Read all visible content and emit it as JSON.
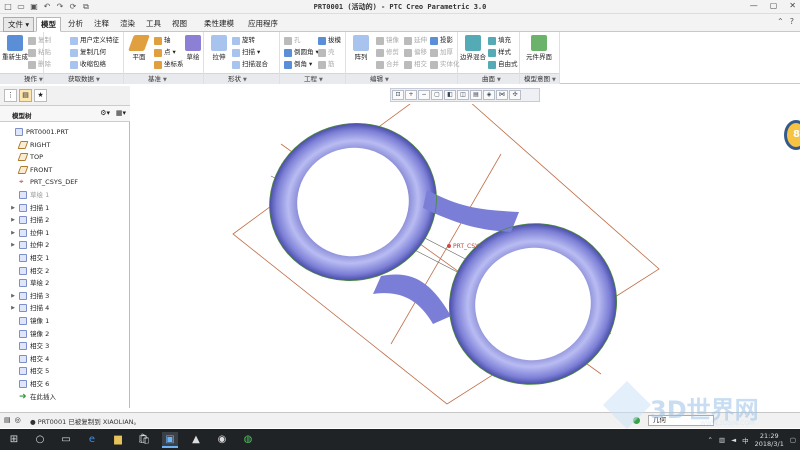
{
  "titlebar": {
    "title": "PRT0001 (活动的) - PTC Creo Parametric 3.0",
    "qat": [
      "new-icon",
      "open-icon",
      "save-icon",
      "undo-icon",
      "redo-icon",
      "regenerate-icon",
      "windows-icon"
    ],
    "controls": [
      "—",
      "▢",
      "✕"
    ]
  },
  "menubar": {
    "file": "文件",
    "tabs": [
      "模型",
      "分析",
      "注释",
      "渲染",
      "工具",
      "视图",
      "柔性建模",
      "应用程序"
    ],
    "active": "模型"
  },
  "ribbon": {
    "groups": [
      {
        "label": "操作",
        "big": "重新生成",
        "small": [
          "复制",
          "粘贴",
          "删除"
        ]
      },
      {
        "label": "获取数据",
        "small": [
          "用户定义特征",
          "复制几何",
          "收缩包络"
        ]
      },
      {
        "label": "基准",
        "big": "平面",
        "big2": "草绘",
        "small": [
          "轴",
          "点",
          "坐标系"
        ]
      },
      {
        "label": "形状",
        "big": "拉伸",
        "small": [
          "旋转",
          "扫描",
          "扫描混合"
        ]
      },
      {
        "label": "工程",
        "small": [
          "孔",
          "倒圆角",
          "倒角",
          "拔模",
          "壳",
          "筋"
        ]
      },
      {
        "label": "编辑",
        "big": "阵列",
        "small": [
          "镜像",
          "延伸",
          "投影",
          "修剪",
          "偏移",
          "加厚",
          "合并",
          "相交",
          "实体化"
        ]
      },
      {
        "label": "曲面",
        "big": "边界混合",
        "small": [
          "填充",
          "样式",
          "自由式"
        ]
      },
      {
        "label": "模型意图",
        "big": "元件界面"
      }
    ]
  },
  "left_panel": {
    "tree_title": "模型树",
    "items": [
      {
        "label": "PRT0001.PRT",
        "type": "part",
        "expandable": false
      },
      {
        "label": "RIGHT",
        "type": "plane",
        "expandable": false
      },
      {
        "label": "TOP",
        "type": "plane",
        "expandable": false
      },
      {
        "label": "FRONT",
        "type": "plane",
        "expandable": false
      },
      {
        "label": "PRT_CSYS_DEF",
        "type": "csys",
        "expandable": false
      },
      {
        "label": "草绘 1",
        "type": "sketch",
        "expandable": false,
        "disabled": true
      },
      {
        "label": "扫描 1",
        "type": "feature",
        "expandable": true
      },
      {
        "label": "扫描 2",
        "type": "feature",
        "expandable": true
      },
      {
        "label": "拉伸 1",
        "type": "feature",
        "expandable": true
      },
      {
        "label": "拉伸 2",
        "type": "feature",
        "expandable": true
      },
      {
        "label": "相交 1",
        "type": "feature",
        "expandable": false
      },
      {
        "label": "相交 2",
        "type": "feature",
        "expandable": false
      },
      {
        "label": "草绘 2",
        "type": "sketch",
        "expandable": false
      },
      {
        "label": "扫描 3",
        "type": "feature",
        "expandable": true
      },
      {
        "label": "扫描 4",
        "type": "feature",
        "expandable": true
      },
      {
        "label": "镜像 1",
        "type": "feature",
        "expandable": false
      },
      {
        "label": "镜像 2",
        "type": "feature",
        "expandable": false
      },
      {
        "label": "相交 3",
        "type": "feature",
        "expandable": false
      },
      {
        "label": "相交 4",
        "type": "feature",
        "expandable": false
      },
      {
        "label": "相交 5",
        "type": "feature",
        "expandable": false
      },
      {
        "label": "相交 6",
        "type": "feature",
        "expandable": false
      },
      {
        "label": "在此插入",
        "type": "insert",
        "expandable": false
      }
    ]
  },
  "graphics": {
    "csys_label": "PRT_CSYS",
    "toolbar": [
      "refit-icon",
      "zoom-in-icon",
      "zoom-out-icon",
      "repaint-icon",
      "display-style-icon",
      "saved-views-icon",
      "view-manager-icon",
      "perspective-icon",
      "datum-display-icon",
      "spin-center-icon"
    ],
    "model_color": "#8a8fe0",
    "plane_color": "#c0704a"
  },
  "status": {
    "message": "● PRT0001 已被复制到 XIAOLIAN。",
    "filter": "几何"
  },
  "watermark": {
    "text": "3D世界网",
    "url": "WWW.3DSJW.COM"
  },
  "taskbar": {
    "time": "21:29",
    "date": "2018/3/1",
    "ime": "中"
  }
}
